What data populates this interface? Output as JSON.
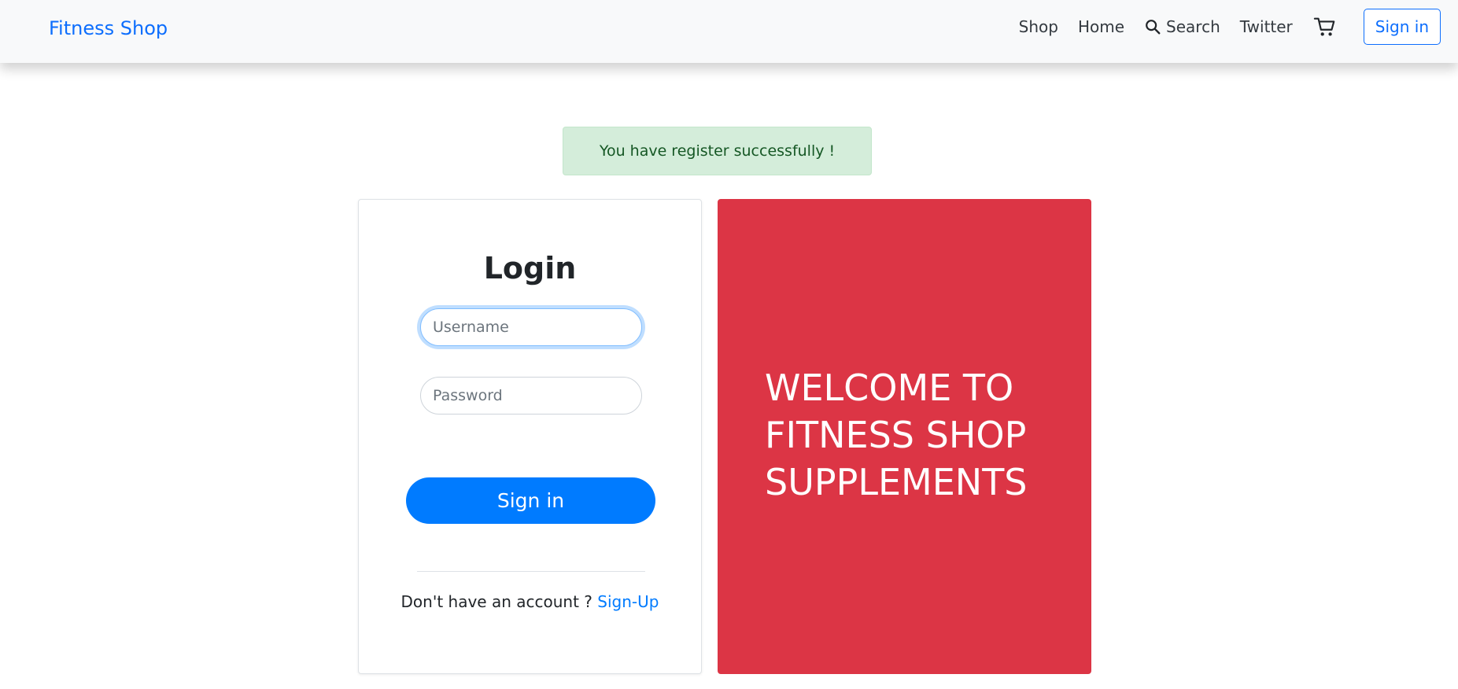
{
  "navbar": {
    "brand": "Fitness Shop",
    "links": {
      "shop": "Shop",
      "home": "Home",
      "search": "Search",
      "twitter": "Twitter"
    },
    "icons": {
      "search": "search-icon",
      "cart": "cart-icon"
    },
    "signin_label": "Sign in"
  },
  "alert": {
    "message": "You have register successfully !"
  },
  "login": {
    "title": "Login",
    "username": {
      "placeholder": "Username",
      "value": ""
    },
    "password": {
      "placeholder": "Password",
      "value": ""
    },
    "submit_label": "Sign in",
    "signup_prompt": "Don't have an account ?",
    "signup_link": "Sign-Up"
  },
  "welcome": {
    "text": "WELCOME TO FITNESS SHOP SUPPLEMENTS"
  },
  "colors": {
    "brand": "#0d6efd",
    "primary_button": "#007bff",
    "welcome_panel": "#dc3545",
    "alert_background": "#d4edda",
    "alert_text": "#155724"
  }
}
